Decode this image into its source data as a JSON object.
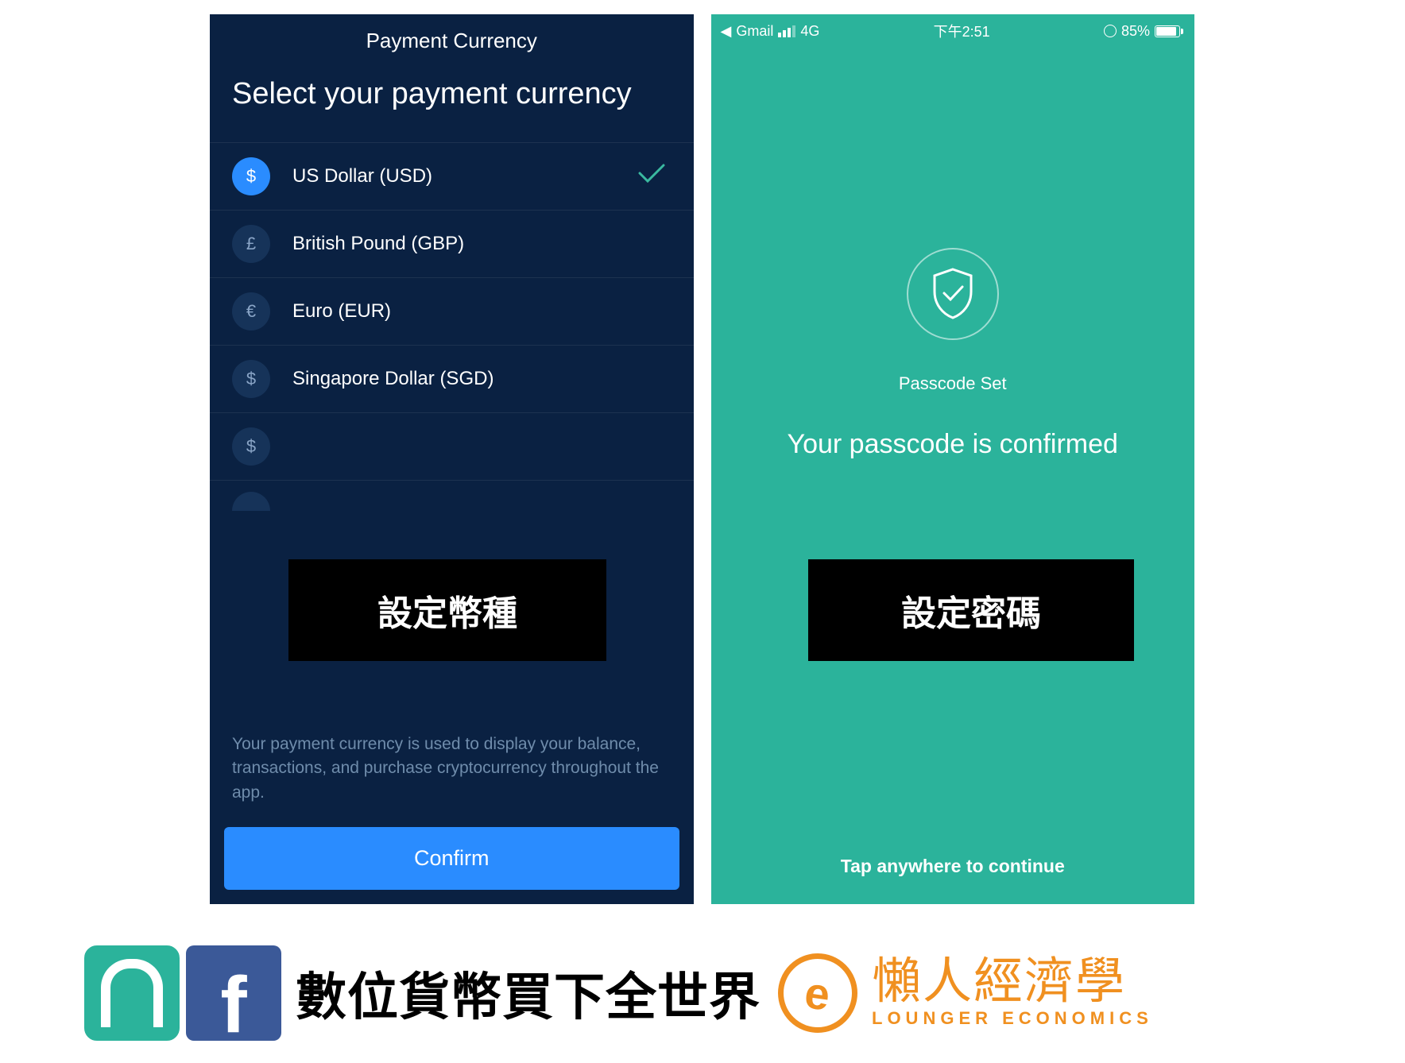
{
  "left": {
    "header_title": "Payment Currency",
    "heading": "Select your payment currency",
    "currencies": [
      {
        "symbol": "$",
        "label": "US Dollar (USD)",
        "selected": true
      },
      {
        "symbol": "£",
        "label": "British Pound (GBP)",
        "selected": false
      },
      {
        "symbol": "€",
        "label": "Euro (EUR)",
        "selected": false
      },
      {
        "symbol": "$",
        "label": "Singapore Dollar (SGD)",
        "selected": false
      },
      {
        "symbol": "$",
        "label": "",
        "selected": false
      }
    ],
    "overlay_label": "設定幣種",
    "info_text": "Your payment currency is used to display your balance, transactions, and purchase cryptocurrency throughout the app.",
    "confirm_label": "Confirm"
  },
  "right": {
    "statusbar": {
      "back_app": "Gmail",
      "network": "4G",
      "time": "下午2:51",
      "battery_pct": "85%"
    },
    "passcode_set": "Passcode Set",
    "confirmed_text": "Your passcode is confirmed",
    "overlay_label": "設定密碼",
    "tap_continue": "Tap anywhere to continue"
  },
  "footer": {
    "text_main": "數位貨幣買下全世界",
    "brand_top": "懶人經濟學",
    "brand_bottom": "LOUNGER ECONOMICS",
    "fb_letter": "f",
    "orange_letter": "e"
  }
}
